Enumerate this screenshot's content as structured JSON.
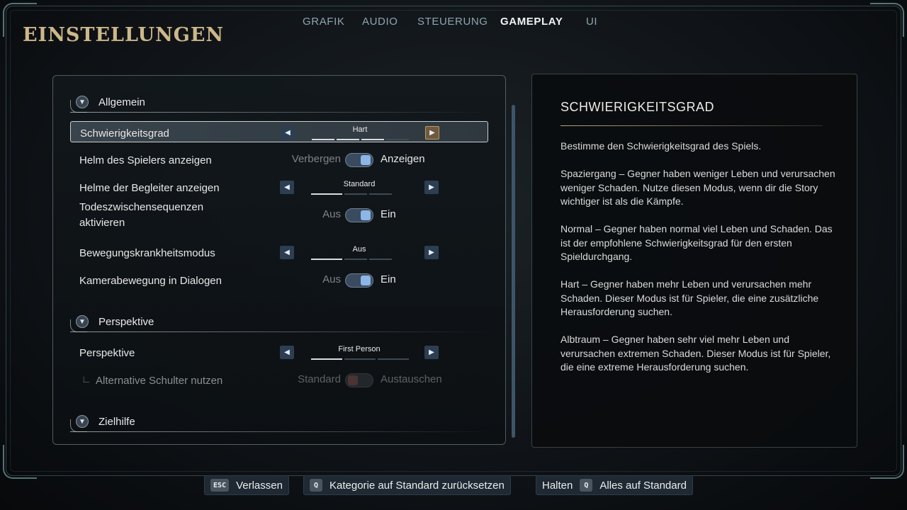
{
  "page_title": "EINSTELLUNGEN",
  "tabs": [
    {
      "label": "GRAFIK",
      "active": false
    },
    {
      "label": "AUDIO",
      "active": false
    },
    {
      "label": "STEUERUNG",
      "active": false
    },
    {
      "label": "GAMEPLAY",
      "active": true
    },
    {
      "label": "UI",
      "active": false
    }
  ],
  "sections": {
    "allgemein": "Allgemein",
    "perspektive": "Perspektive",
    "zielhilfe": "Zielhilfe"
  },
  "settings": {
    "schwierigkeitsgrad": {
      "label": "Schwierigkeitsgrad",
      "value": "Hart",
      "level": 3,
      "levels": 4
    },
    "helm_spieler": {
      "label": "Helm des Spielers anzeigen",
      "off_label": "Verbergen",
      "on_label": "Anzeigen",
      "state": "on"
    },
    "helme_begleiter": {
      "label": "Helme der Begleiter anzeigen",
      "value": "Standard",
      "level": 1,
      "levels": 4
    },
    "todes": {
      "label_line1": "Todeszwischensequenzen",
      "label_line2": "aktivieren",
      "off_label": "Aus",
      "on_label": "Ein",
      "state": "on"
    },
    "bewegung": {
      "label": "Bewegungskrankheitsmodus",
      "value": "Aus",
      "level": 1,
      "levels": 4
    },
    "kamera": {
      "label": "Kamerabewegung in Dialogen",
      "off_label": "Aus",
      "on_label": "Ein",
      "state": "on"
    },
    "perspektive": {
      "label": "Perspektive",
      "value": "First Person",
      "level": 1,
      "levels": 3
    },
    "schulter": {
      "label": "Alternative Schulter nutzen",
      "off_label": "Standard",
      "on_label": "Austauschen",
      "state": "off",
      "disabled": true
    }
  },
  "description": {
    "title": "SCHWIERIGKEITSGRAD",
    "paragraphs": [
      "Bestimme den Schwierigkeitsgrad des Spiels.",
      "Spaziergang – Gegner haben weniger Leben und verursachen weniger Schaden. Nutze diesen Modus, wenn dir die Story wichtiger ist als die Kämpfe.",
      "Normal – Gegner haben normal viel Leben und Schaden. Das ist der empfohlene Schwierigkeitsgrad für den ersten Spieldurchgang.",
      "Hart – Gegner haben mehr Leben und verursachen mehr Schaden. Dieser Modus ist für Spieler, die eine zusätzliche Herausforderung suchen.",
      "Albtraum – Gegner haben sehr viel mehr Leben und verursachen extremen Schaden. Dieser Modus ist für Spieler, die eine extreme Herausforderung suchen."
    ]
  },
  "footer": {
    "leave": {
      "key": "ESC",
      "label": "Verlassen"
    },
    "reset_category": {
      "key": "Q",
      "label": "Kategorie auf Standard zurücksetzen"
    },
    "reset_all": {
      "prefix": "Halten",
      "key": "Q",
      "label": "Alles auf Standard"
    }
  },
  "colors": {
    "title_gold": "#cdb78a",
    "toggle_knob": "#8cb6e6",
    "active_arrow": "#6f5a3a"
  }
}
